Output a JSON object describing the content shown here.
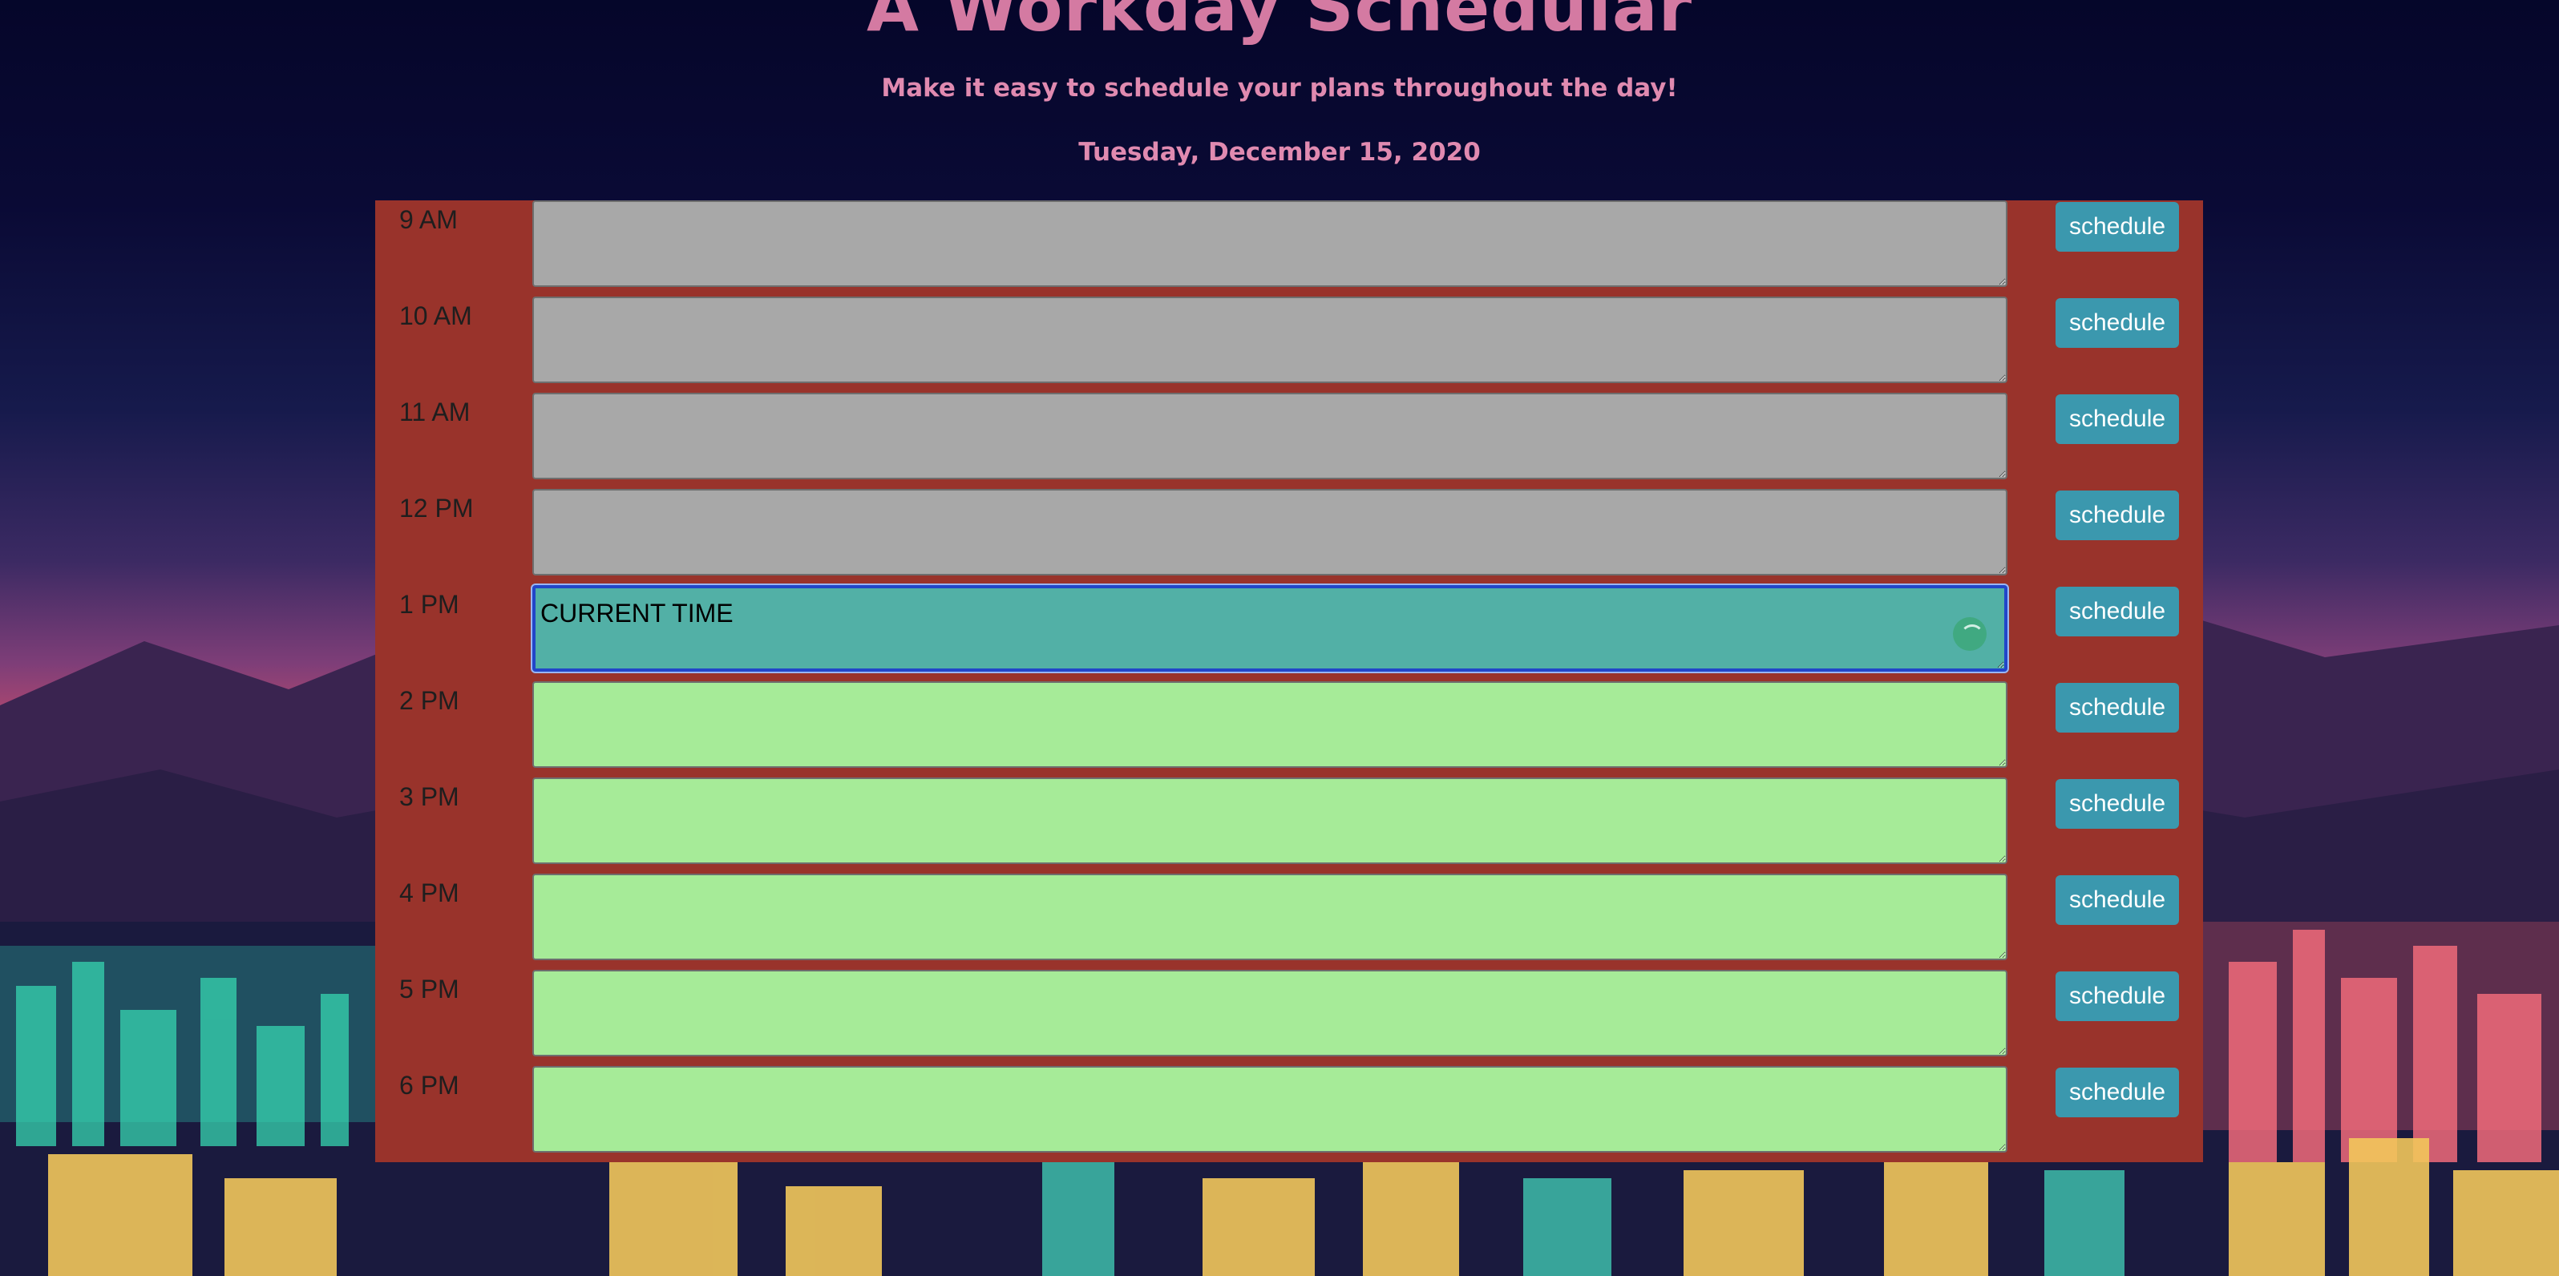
{
  "header": {
    "title": "A Workday Schedular",
    "lead": "Make it easy to schedule your plans throughout the day!",
    "current_day": "Tuesday, December 15, 2020"
  },
  "colors": {
    "planner_bg": "#99332b",
    "past": "#a8a8a8",
    "present": "#52b0a6",
    "future": "#a6eb98",
    "button": "#3b98ae",
    "title": "#d47aa2"
  },
  "rows": [
    {
      "hour": "9 AM",
      "text": "",
      "state": "past",
      "button": "schedule"
    },
    {
      "hour": "10 AM",
      "text": "",
      "state": "past",
      "button": "schedule"
    },
    {
      "hour": "11 AM",
      "text": "",
      "state": "past",
      "button": "schedule"
    },
    {
      "hour": "12 PM",
      "text": "",
      "state": "past",
      "button": "schedule"
    },
    {
      "hour": "1 PM",
      "text": "CURRENT TIME",
      "state": "present",
      "button": "schedule"
    },
    {
      "hour": "2 PM",
      "text": "",
      "state": "future",
      "button": "schedule"
    },
    {
      "hour": "3 PM",
      "text": "",
      "state": "future",
      "button": "schedule"
    },
    {
      "hour": "4 PM",
      "text": "",
      "state": "future",
      "button": "schedule"
    },
    {
      "hour": "5 PM",
      "text": "",
      "state": "future",
      "button": "schedule"
    },
    {
      "hour": "6 PM",
      "text": "",
      "state": "future",
      "button": "schedule"
    }
  ]
}
